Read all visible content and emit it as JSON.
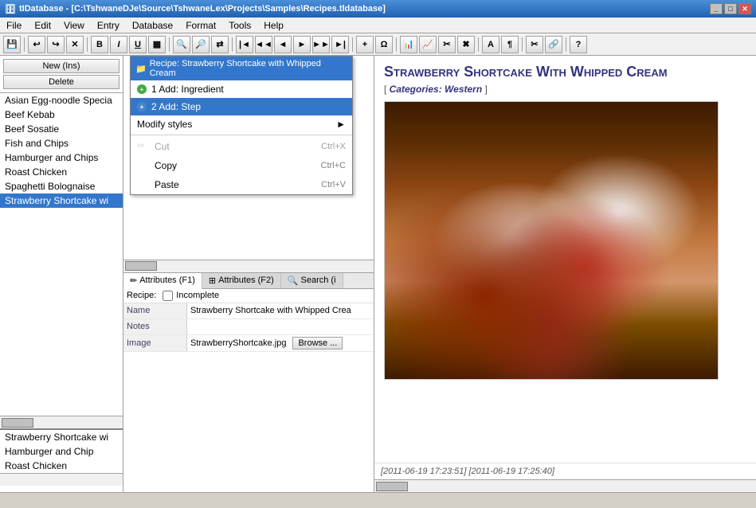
{
  "window": {
    "title": "tIDatabase - [C:\\TshwaneDJe\\Source\\TshwaneLex\\Projects\\Samples\\Recipes.tldatabase]",
    "icon": "db-icon"
  },
  "menubar": {
    "items": [
      "File",
      "Edit",
      "View",
      "Entry",
      "Database",
      "Format",
      "Tools",
      "Help"
    ]
  },
  "toolbar": {
    "buttons": [
      "save",
      "undo",
      "redo",
      "delete",
      "bold",
      "italic",
      "underline",
      "table",
      "search-left",
      "search-right",
      "search-replace",
      "nav-first",
      "nav-prev-prev",
      "nav-prev",
      "nav-next",
      "nav-next-next",
      "nav-last",
      "add",
      "symbol",
      "chart",
      "graph",
      "cut",
      "close",
      "letter-a",
      "paragraph",
      "scissors",
      "link",
      "help"
    ]
  },
  "left_panel": {
    "new_button": "New (Ins)",
    "delete_button": "Delete",
    "entries": [
      {
        "label": "Asian Egg-noodle Specia",
        "selected": false
      },
      {
        "label": "Beef Kebab",
        "selected": false
      },
      {
        "label": "Beef Sosatie",
        "selected": false
      },
      {
        "label": "Fish and Chips",
        "selected": false
      },
      {
        "label": "Hamburger and Chips",
        "selected": false
      },
      {
        "label": "Roast Chicken",
        "selected": false
      },
      {
        "label": "Spaghetti Bolognaise",
        "selected": false
      },
      {
        "label": "Strawberry Shortcake wi",
        "selected": true
      }
    ],
    "bottom_entries": [
      {
        "label": "Strawberry Shortcake wi"
      },
      {
        "label": "Hamburger and Chip"
      },
      {
        "label": "Roast Chicken"
      }
    ]
  },
  "context_menu": {
    "header": "Recipe: Strawberry Shortcake with Whipped Cream",
    "items": [
      {
        "id": "add-ingredient",
        "icon": "+",
        "label": "1 Add: Ingredient",
        "shortcut": "",
        "selected": false
      },
      {
        "id": "add-step",
        "icon": "+",
        "label": "2 Add: Step",
        "shortcut": "",
        "selected": true
      },
      {
        "id": "modify-styles",
        "icon": "",
        "label": "Modify styles",
        "shortcut": "►",
        "selected": false
      },
      {
        "separator": true
      },
      {
        "id": "cut",
        "icon": "✂",
        "label": "Cut",
        "shortcut": "Ctrl+X",
        "disabled": true
      },
      {
        "id": "copy",
        "icon": "",
        "label": "Copy",
        "shortcut": "Ctrl+C",
        "disabled": false
      },
      {
        "id": "paste",
        "icon": "",
        "label": "Paste",
        "shortcut": "Ctrl+V",
        "disabled": false
      }
    ]
  },
  "tabs": {
    "tabs": [
      {
        "label": "Attributes (F1)",
        "icon": "pencil",
        "active": true
      },
      {
        "label": "Attributes (F2)",
        "icon": "grid",
        "active": false
      },
      {
        "label": "Search (i",
        "icon": "search",
        "active": false
      }
    ]
  },
  "attributes": {
    "recipe_label": "Recipe:",
    "incomplete_label": "Incomplete",
    "fields": [
      {
        "label": "Name",
        "value": "Strawberry Shortcake with Whipped Crea"
      },
      {
        "label": "Notes",
        "value": ""
      },
      {
        "label": "Image",
        "value": "StrawberryShortcake.jpg",
        "browse_button": "Browse ..."
      }
    ]
  },
  "preview": {
    "title": "Strawberry Shortcake with Whipped Cream",
    "categories_label": "Categories:",
    "categories_value": "Western",
    "footer_timestamps": "[2011-06-19 17:23:51] [2011-06-19 17:25:40]"
  },
  "search_tab": {
    "label": "Search"
  }
}
